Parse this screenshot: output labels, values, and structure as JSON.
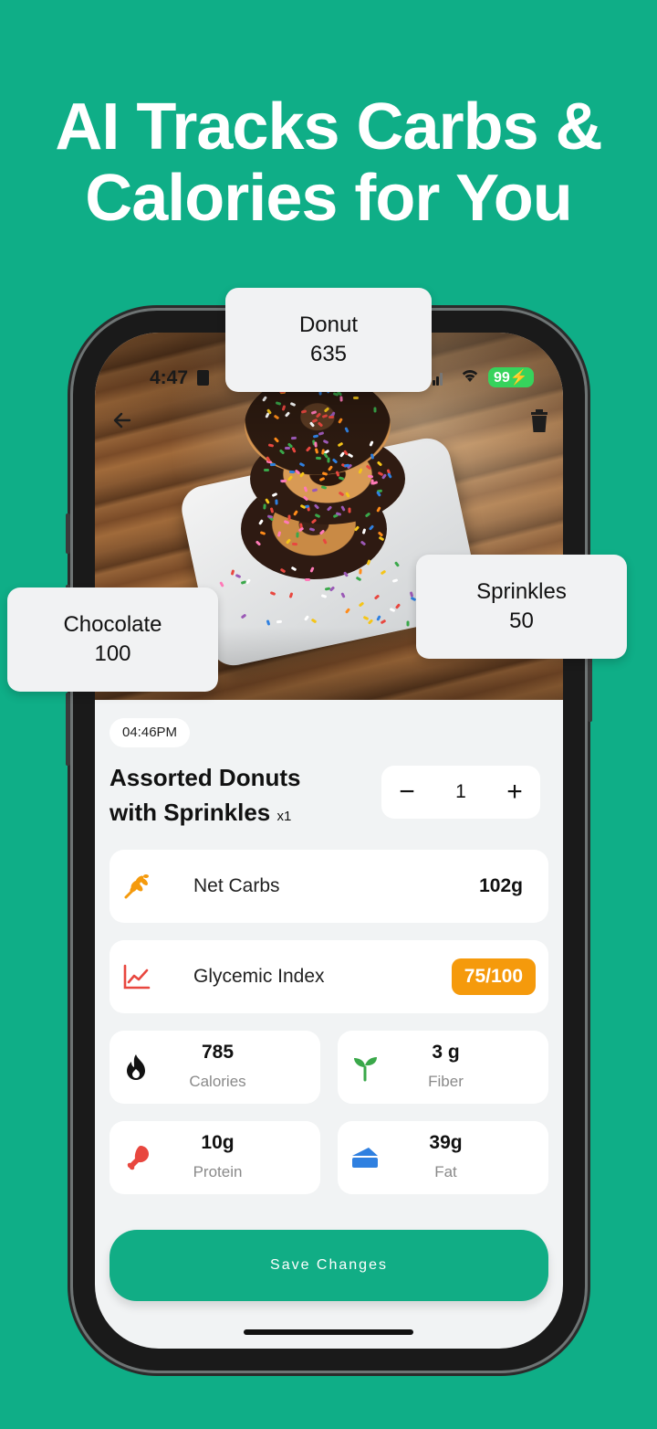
{
  "headline": {
    "line1": "AI Tracks Carbs &",
    "line2": "Calories for You"
  },
  "status_bar": {
    "time": "4:47",
    "battery": "99"
  },
  "nav": {
    "back_icon": "arrow-left-icon",
    "delete_icon": "trash-icon"
  },
  "meal": {
    "time": "04:46PM",
    "title_line1": "Assorted Donuts",
    "title_line2": "with Sprinkles",
    "multiplier": "x1",
    "quantity": "1"
  },
  "stepper": {
    "minus": "−",
    "plus": "+"
  },
  "nutrition": {
    "net_carbs": {
      "label": "Net Carbs",
      "value": "102g",
      "icon": "wheat-icon",
      "color": "#f59a0c"
    },
    "glycemic_index": {
      "label": "Glycemic Index",
      "value": "75/100",
      "icon": "trend-chart-icon",
      "color": "#e8473f"
    },
    "calories": {
      "value": "785",
      "label": "Calories",
      "icon": "flame-icon"
    },
    "fiber": {
      "value": "3 g",
      "label": "Fiber",
      "icon": "sprout-icon",
      "color": "#3aa84a"
    },
    "protein": {
      "value": "10g",
      "label": "Protein",
      "icon": "drumstick-icon",
      "color": "#e8473f"
    },
    "fat": {
      "value": "39g",
      "label": "Fat",
      "icon": "cheese-icon",
      "color": "#2f80e0"
    }
  },
  "save_button": {
    "label": "Save Changes"
  },
  "callouts": [
    {
      "name": "Donut",
      "value": "635"
    },
    {
      "name": "Chocolate",
      "value": "100"
    },
    {
      "name": "Sprinkles",
      "value": "50"
    }
  ],
  "colors": {
    "background": "#0fae87",
    "accent": "#11ad85",
    "badge": "#f59a0c"
  }
}
